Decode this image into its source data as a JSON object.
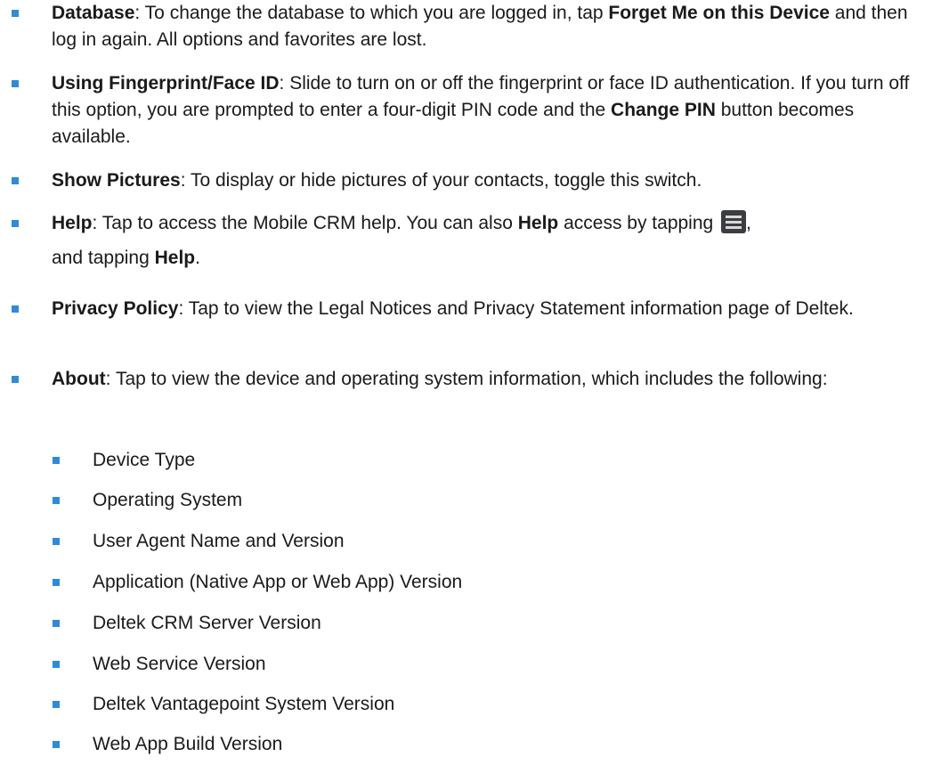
{
  "items": [
    {
      "term": "Database",
      "text_1": ": To change the database to which you are logged in, tap ",
      "bold_1": "Forget Me on this Device",
      "text_2": " and then log in again. All options and favorites are lost."
    },
    {
      "term": "Using Fingerprint/Face ID",
      "text_1": ": Slide to turn on or off the fingerprint or face ID authentication. If you turn off this option, you are prompted to enter a four-digit PIN code and the ",
      "bold_1": "Change PIN",
      "text_2": " button becomes available."
    },
    {
      "term": "Show Pictures",
      "text_1": ": To display or hide pictures of your contacts, toggle this switch."
    },
    {
      "term": "Help",
      "text_1": ": Tap to access the Mobile CRM help. You can also ",
      "bold_1": "Help",
      "text_2": " access by tapping ",
      "icon": "menu-icon",
      "text_3": ",",
      "text_4": "and tapping ",
      "bold_2": "Help",
      "text_5": "."
    },
    {
      "term": "Privacy Policy",
      "text_1": ": Tap to view the Legal Notices and Privacy Statement information page of Deltek."
    },
    {
      "term": "About",
      "text_1": ": Tap to view the device and operating system information, which includes the following:"
    }
  ],
  "about_subitems": [
    "Device Type",
    "Operating System",
    "User Agent Name and Version",
    "Application (Native App or Web App) Version",
    "Deltek CRM Server Version",
    "Web Service Version",
    "Deltek Vantagepoint System Version",
    "Web App Build Version"
  ],
  "colors": {
    "bullet": "#2e8bd8",
    "text": "#1a1a1a",
    "icon_bg": "#3c3d40"
  }
}
